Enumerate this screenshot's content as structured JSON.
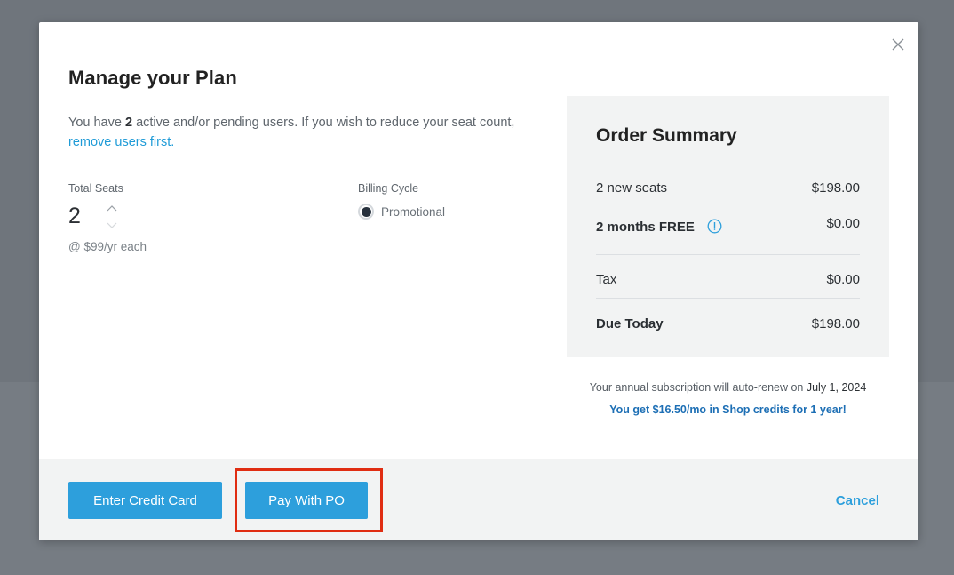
{
  "modal": {
    "title": "Manage your Plan",
    "intro_prefix": "You have ",
    "intro_count": "2",
    "intro_suffix": " active and/or pending users. If you wish to reduce your seat count,",
    "intro_link": "remove users first."
  },
  "seats": {
    "label": "Total Seats",
    "value": "2",
    "price": "@ $99/yr each"
  },
  "billing": {
    "label": "Billing Cycle",
    "option": "Promotional",
    "selected": true
  },
  "summary": {
    "title": "Order Summary",
    "rows": [
      {
        "label": "2 new seats",
        "amount": "$198.00"
      },
      {
        "label": "2 months FREE",
        "amount": "$0.00",
        "info_icon": "info-circle-icon"
      },
      {
        "label": "Tax",
        "amount": "$0.00"
      },
      {
        "label": "Due Today",
        "amount": "$198.00"
      }
    ]
  },
  "notes": {
    "renew_text": "Your annual subscription will auto-renew on ",
    "renew_date": "July 1, 2024",
    "credit_text": "You get $16.50/mo in Shop credits for 1 year!"
  },
  "footer": {
    "card_button": "Enter Credit Card",
    "po_button": "Pay With PO",
    "cancel": "Cancel"
  },
  "colors": {
    "accent": "#2d9fdc",
    "link": "#1f9bd7",
    "credit_note": "#1d6fb5",
    "highlight": "#e02d12",
    "backdrop": "#6f757c"
  },
  "icons": {
    "close": "close-icon",
    "stepper_up": "chevron-up-icon",
    "stepper_down": "chevron-down-icon",
    "info": "info-circle-icon"
  }
}
